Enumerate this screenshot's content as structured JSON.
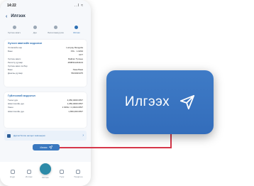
{
  "status": {
    "time": "14:22",
    "signal": "..l ≈"
  },
  "header": {
    "back": "‹",
    "title": "Илгээх"
  },
  "steps": [
    {
      "label": "Хүлээн авагч",
      "active": false
    },
    {
      "label": "Дүн",
      "active": false
    },
    {
      "label": "Баталгаажуулах",
      "active": false
    },
    {
      "label": "Илгээх",
      "active": true
    }
  ],
  "recipient_card": {
    "title": "Хүлээн авагчийн мэдээлэл",
    "rows": [
      {
        "k": "Хэтэвчийн нэр",
        "v": "Lumpay Mongolia"
      },
      {
        "k": "Банк",
        "v": "XXL · 1.0234"
      },
      {
        "k": "",
        "v": "CFT"
      },
      {
        "k": "Хүлээн авагч",
        "v": "Байгал Тулхын"
      },
      {
        "k": "Регистр дугаар",
        "v": "4838311234104"
      },
      {
        "k": "Хүлээн авах хэлбэр",
        "v": ""
      },
      {
        "k": "Банк",
        "v": "Хаан Банк"
      },
      {
        "k": "Дансны дугаар",
        "v": "5613023475"
      }
    ]
  },
  "transfer_card": {
    "title": "Гүйлгээний мэдээлэл",
    "rows": [
      {
        "k": "Төлөх дүн",
        "v": "4,050,0000 MNT"
      },
      {
        "k": "Шимтгэлийн дүн",
        "v": "1,050,0000 MNT"
      },
      {
        "k": "Ханш",
        "v": "1 MNG = 2,0024 MNT"
      },
      {
        "k": "Шимтгэлийн дүн",
        "v": "1,650,000 MNT"
      }
    ]
  },
  "notice": {
    "text": "Дүрэм болон нөхцөл зөвшөөрөх",
    "chevron": "›"
  },
  "send_small": {
    "label": "Илгээх",
    "icon": "send-icon"
  },
  "tabbar": [
    {
      "label": "Нүүр",
      "center": false
    },
    {
      "label": "Илгээх",
      "center": false
    },
    {
      "label": "Илгээх",
      "center": true
    },
    {
      "label": "Түүх",
      "center": false
    },
    {
      "label": "Тохиргоо",
      "center": false
    }
  ],
  "send_big": {
    "label": "Илгээх",
    "icon": "send-icon",
    "color": "#3a75c2"
  },
  "connector_color": "#d6374a"
}
